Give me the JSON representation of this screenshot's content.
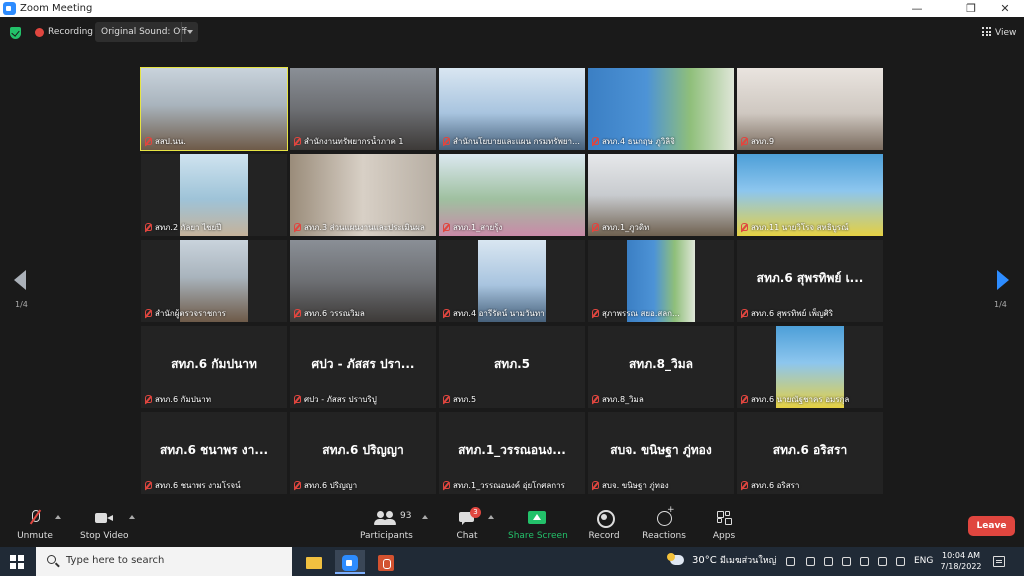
{
  "window": {
    "title": "Zoom Meeting"
  },
  "topbar": {
    "recording_label": "Recording",
    "original_sound_label": "Original Sound: Off",
    "view_label": "View"
  },
  "nav": {
    "left_page": "1/4",
    "right_page": "1/4"
  },
  "tiles": [
    {
      "name": "สสป.นน.",
      "kind": "video",
      "active": true
    },
    {
      "name": "สำนักงานทรัพยากรน้ำภาค 1",
      "kind": "video"
    },
    {
      "name": "สำนักนโยบายและแผน กรมทรัพยาก...",
      "kind": "video"
    },
    {
      "name": "สทภ.4 ธนกฤษ ภูวิลิจิ",
      "kind": "video"
    },
    {
      "name": "สทภ.9",
      "kind": "video"
    },
    {
      "name": "สทภ.2 กัลยา ไชยปี",
      "kind": "video_narrow"
    },
    {
      "name": "สทภ.3 ส่วนแผนงานและประเมินผล",
      "kind": "video"
    },
    {
      "name": "สทภ.1_สายรุ้ง",
      "kind": "video"
    },
    {
      "name": "สทภ.1_ภูวดิท",
      "kind": "video"
    },
    {
      "name": "สทภ.11 นายวิโรจ สหธิบูรณ์",
      "kind": "video"
    },
    {
      "name": "สำนักผู้ตรวจราชการ",
      "kind": "video_narrow"
    },
    {
      "name": "สทภ.6 วรรณวิมล",
      "kind": "video"
    },
    {
      "name": "สทภ.4 อารีรัตน์ นามวันทา",
      "kind": "video_narrow"
    },
    {
      "name": "สุภาพรรณ สยอ.สลก...",
      "kind": "video_narrow"
    },
    {
      "name": "สทภ.6 สุพรทิพย์ เพ็ญศิริ",
      "big": "สทภ.6 สุพรทิพย์ เ...",
      "kind": "name"
    },
    {
      "name": "สทภ.6   กัมปนาท",
      "big": "สทภ.6   กัมปนาท",
      "kind": "name"
    },
    {
      "name": "ศปว - ภัสสร ปราบริปู",
      "big": "ศปว - ภัสสร ปรา...",
      "kind": "name"
    },
    {
      "name": "สทภ.5",
      "big": "สทภ.5",
      "kind": "name"
    },
    {
      "name": "สทภ.8_วิมล",
      "big": "สทภ.8_วิมล",
      "kind": "name"
    },
    {
      "name": "สทภ.6 นายณัฐชาคร อมรกุล",
      "kind": "video_narrow"
    },
    {
      "name": "สทภ.6 ชนาพร งามโรจน์",
      "big": "สทภ.6 ชนาพร งา...",
      "kind": "name"
    },
    {
      "name": "สทภ.6 ปริญญา",
      "big": "สทภ.6 ปริญญา",
      "kind": "name"
    },
    {
      "name": "สทภ.1_วรรณอนงค์ อุ่ยโกศลการ",
      "big": "สทภ.1_วรรณอนง...",
      "kind": "name"
    },
    {
      "name": "สบจ. ขนิษฐา ภู่ทอง",
      "big": "สบจ. ขนิษฐา ภู่ทอง",
      "kind": "name"
    },
    {
      "name": "สทภ.6 อริสรา",
      "big": "สทภ.6 อริสรา",
      "kind": "name"
    }
  ],
  "toolbar": {
    "unmute": "Unmute",
    "stop_video": "Stop Video",
    "participants": "Participants",
    "participant_count": "93",
    "chat": "Chat",
    "chat_badge": "3",
    "share_screen": "Share Screen",
    "record": "Record",
    "reactions": "Reactions",
    "apps": "Apps",
    "leave": "Leave"
  },
  "taskbar": {
    "search_placeholder": "Type here to search",
    "temperature": "30°C",
    "weather_location": "มีเมฆส่วนใหญ่",
    "language": "ENG",
    "time": "10:04 AM",
    "date": "7/18/2022"
  },
  "colors": {
    "accent": "#2d8cff",
    "active_speaker": "#e7e443",
    "leave": "#e0463f",
    "share": "#23c16a"
  }
}
